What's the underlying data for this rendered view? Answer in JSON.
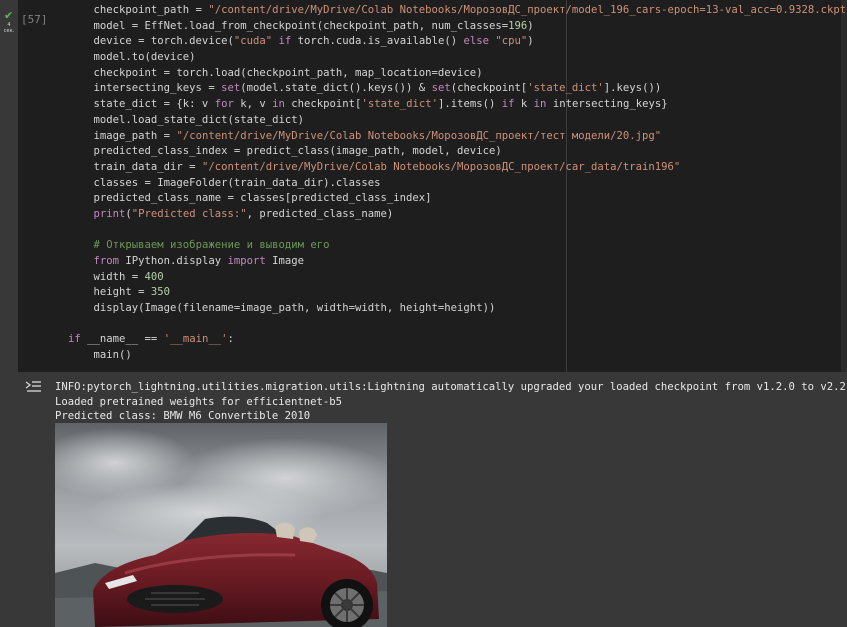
{
  "cell": {
    "status_icon": "check-icon",
    "run_time": "4\nсек.",
    "execution_count": "[57]"
  },
  "code": {
    "lines": [
      [
        [
          "    checkpoint_path = ",
          "default"
        ],
        [
          "\"/content/drive/MyDrive/Colab Notebooks/МорозовДС_проект/model_196_cars-epoch=13-val_acc=0.9328.ckpt\"",
          "str"
        ]
      ],
      [
        [
          "    model = EffNet.load_from_checkpoint(checkpoint_path, num_classes=",
          "default"
        ],
        [
          "196",
          "num"
        ],
        [
          ")",
          "default"
        ]
      ],
      [
        [
          "    device = torch.device(",
          "default"
        ],
        [
          "\"cuda\"",
          "str"
        ],
        [
          " ",
          "default"
        ],
        [
          "if",
          "kw"
        ],
        [
          " torch.cuda.is_available() ",
          "default"
        ],
        [
          "else",
          "kw"
        ],
        [
          " ",
          "default"
        ],
        [
          "\"cpu\"",
          "str"
        ],
        [
          ")",
          "default"
        ]
      ],
      [
        [
          "    model.to(device)",
          "default"
        ]
      ],
      [
        [
          "    checkpoint = torch.load(checkpoint_path, map_location=device)",
          "default"
        ]
      ],
      [
        [
          "    intersecting_keys = ",
          "default"
        ],
        [
          "set",
          "kw"
        ],
        [
          "(model.state_dict().keys()) & ",
          "default"
        ],
        [
          "set",
          "kw"
        ],
        [
          "(checkpoint[",
          "default"
        ],
        [
          "'state_dict'",
          "str"
        ],
        [
          "].keys())",
          "default"
        ]
      ],
      [
        [
          "    state_dict = {k: v ",
          "default"
        ],
        [
          "for",
          "kw"
        ],
        [
          " k, v ",
          "default"
        ],
        [
          "in",
          "kw"
        ],
        [
          " checkpoint[",
          "default"
        ],
        [
          "'state_dict'",
          "str"
        ],
        [
          "].items() ",
          "default"
        ],
        [
          "if",
          "kw"
        ],
        [
          " k ",
          "default"
        ],
        [
          "in",
          "kw"
        ],
        [
          " intersecting_keys}",
          "default"
        ]
      ],
      [
        [
          "    model.load_state_dict(state_dict)",
          "default"
        ]
      ],
      [
        [
          "    image_path = ",
          "default"
        ],
        [
          "\"/content/drive/MyDrive/Colab Notebooks/МорозовДС_проект/тест модели/20.jpg\"",
          "str"
        ]
      ],
      [
        [
          "    predicted_class_index = predict_class(image_path, model, device)",
          "default"
        ]
      ],
      [
        [
          "    train_data_dir = ",
          "default"
        ],
        [
          "\"/content/drive/MyDrive/Colab Notebooks/МорозовДС_проект/car_data/train196\"",
          "str"
        ]
      ],
      [
        [
          "    classes = ImageFolder(train_data_dir).classes",
          "default"
        ]
      ],
      [
        [
          "    predicted_class_name = classes[predicted_class_index]",
          "default"
        ]
      ],
      [
        [
          "    ",
          "default"
        ],
        [
          "print",
          "kw"
        ],
        [
          "(",
          "default"
        ],
        [
          "\"Predicted class:\"",
          "str"
        ],
        [
          ", predicted_class_name)",
          "default"
        ]
      ],
      [
        [
          "",
          "default"
        ]
      ],
      [
        [
          "    ",
          "default"
        ],
        [
          "# Открываем изображение и выводим его",
          "com"
        ]
      ],
      [
        [
          "    ",
          "default"
        ],
        [
          "from",
          "kw"
        ],
        [
          " IPython.display ",
          "default"
        ],
        [
          "import",
          "kw"
        ],
        [
          " Image",
          "default"
        ]
      ],
      [
        [
          "    width = ",
          "default"
        ],
        [
          "400",
          "num"
        ]
      ],
      [
        [
          "    height = ",
          "default"
        ],
        [
          "350",
          "num"
        ]
      ],
      [
        [
          "    display(Image(filename=image_path, width=width, height=height))",
          "default"
        ]
      ],
      [
        [
          "",
          "default"
        ]
      ],
      [
        [
          "if",
          "kw"
        ],
        [
          " __name__ == ",
          "default"
        ],
        [
          "'__main__'",
          "str"
        ],
        [
          ":",
          "default"
        ]
      ],
      [
        [
          "    main()",
          "default"
        ]
      ]
    ]
  },
  "output": {
    "icon": "output-options-icon",
    "lines": [
      "INFO:pytorch_lightning.utilities.migration.utils:Lightning automatically upgraded your loaded checkpoint from v1.2.0 to v2.2",
      "Loaded pretrained weights for efficientnet-b5",
      "Predicted class: BMW M6 Convertible 2010"
    ],
    "image_subject": "red-convertible-car-photo"
  },
  "colors": {
    "editor_bg": "#1e1e1e",
    "output_bg": "#383838",
    "string": "#ce9178",
    "keyword": "#c586c0",
    "number": "#b5cea8",
    "comment": "#6a9955",
    "check": "#5fb760"
  }
}
